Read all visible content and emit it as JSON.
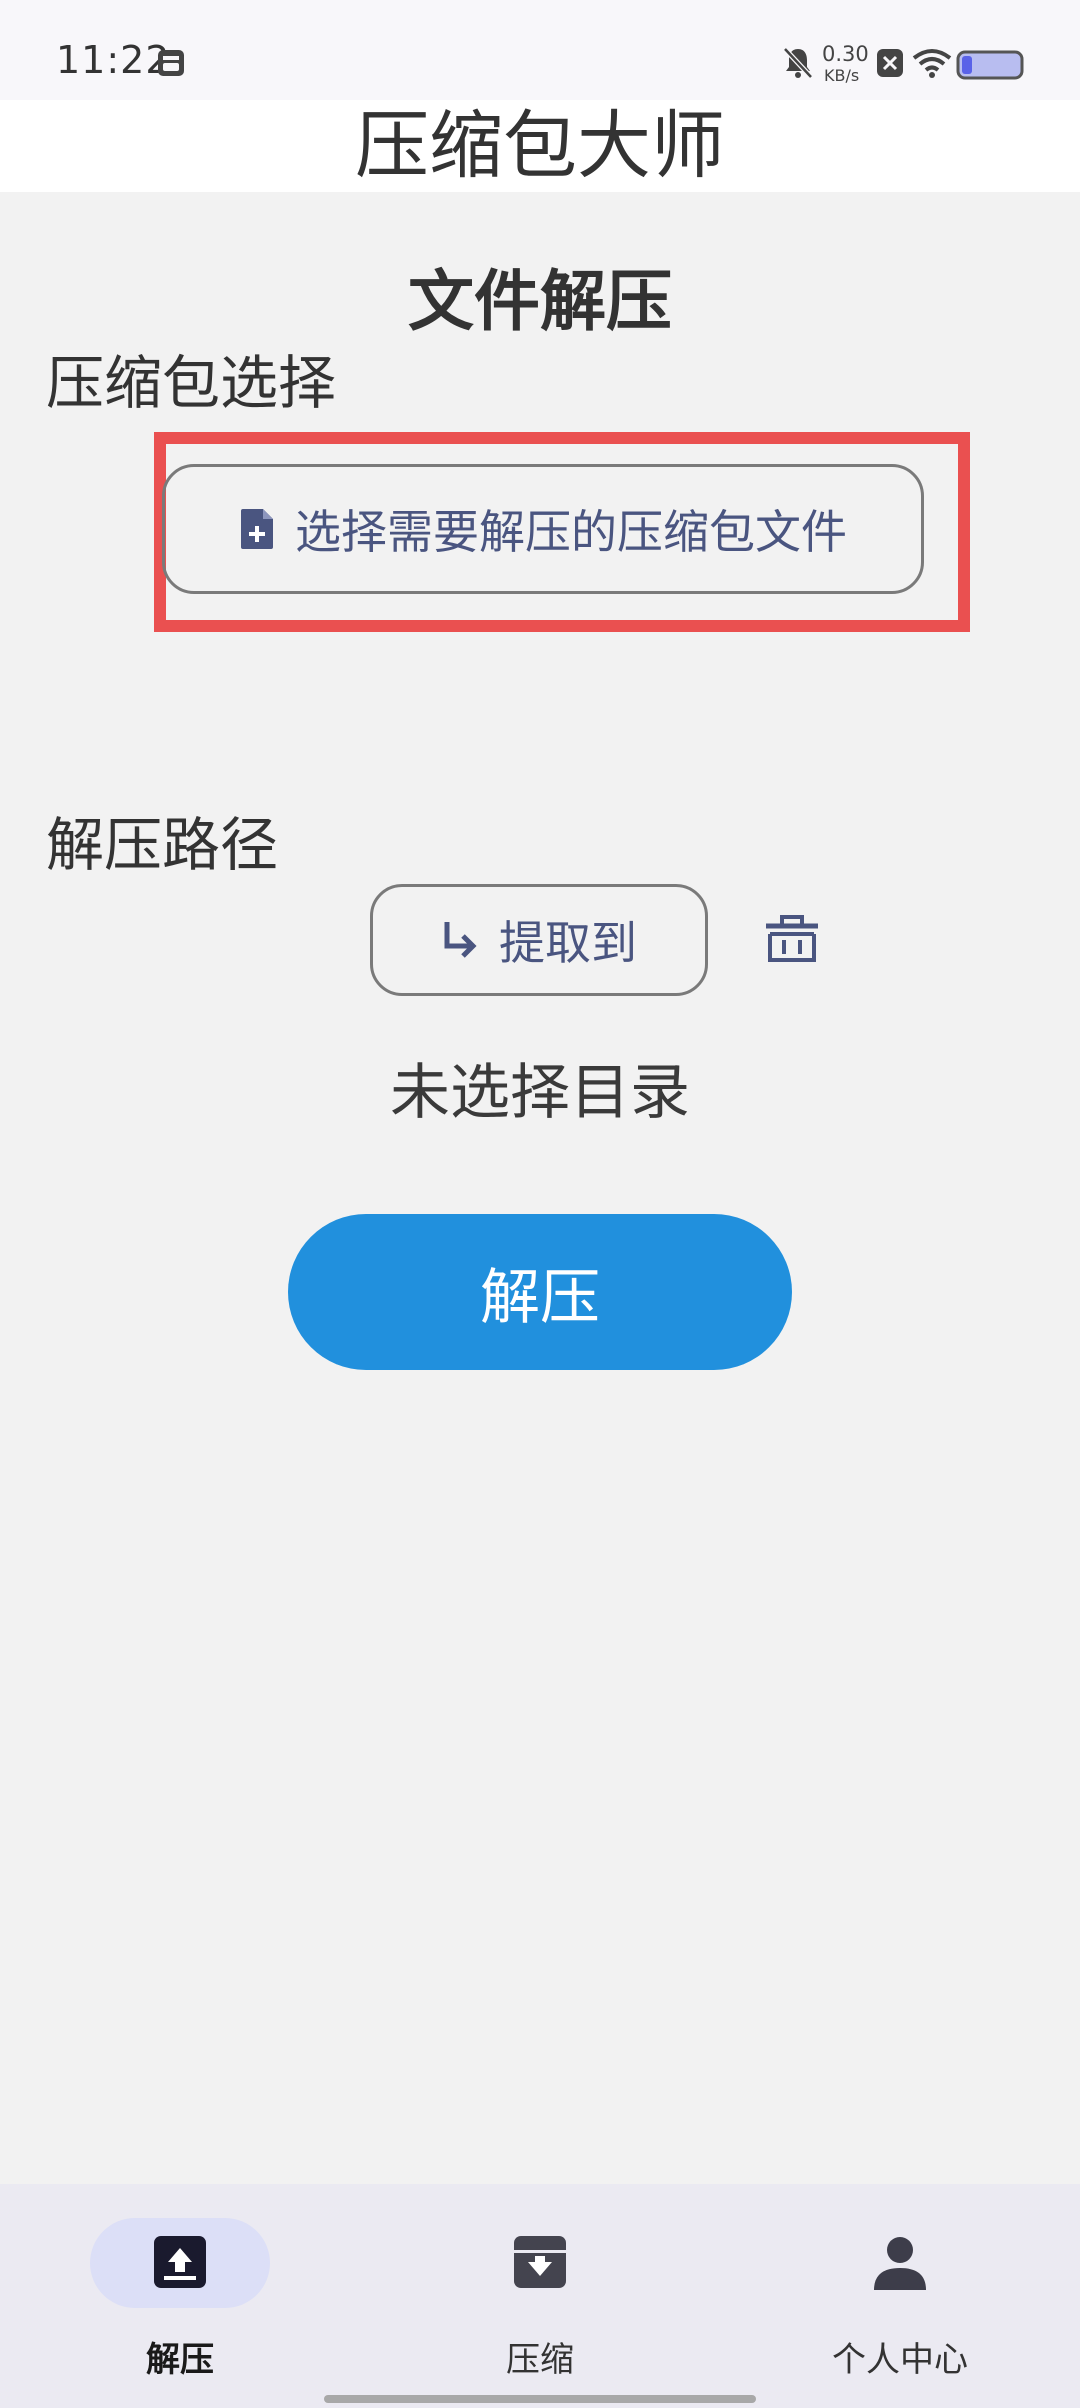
{
  "status_bar": {
    "time": "11:22",
    "net_speed_value": "0.30",
    "net_speed_unit": "KB/s"
  },
  "app": {
    "title": "压缩包大师"
  },
  "page": {
    "title": "文件解压"
  },
  "archive_section": {
    "label": "压缩包选择",
    "select_button_label": "选择需要解压的压缩包文件"
  },
  "path_section": {
    "label": "解压路径",
    "extract_button_label": "提取到",
    "no_dir_text": "未选择目录"
  },
  "actions": {
    "extract_label": "解压"
  },
  "bottom_nav": {
    "items": [
      {
        "label": "解压",
        "icon": "archive-up-icon",
        "active": true
      },
      {
        "label": "压缩",
        "icon": "archive-down-icon",
        "active": false
      },
      {
        "label": "个人中心",
        "icon": "person-icon",
        "active": false
      }
    ]
  },
  "colors": {
    "primary": "#2190dd",
    "highlight": "#ea5050",
    "accent_text": "#4a5580",
    "nav_active_pill": "#dcdff7"
  }
}
